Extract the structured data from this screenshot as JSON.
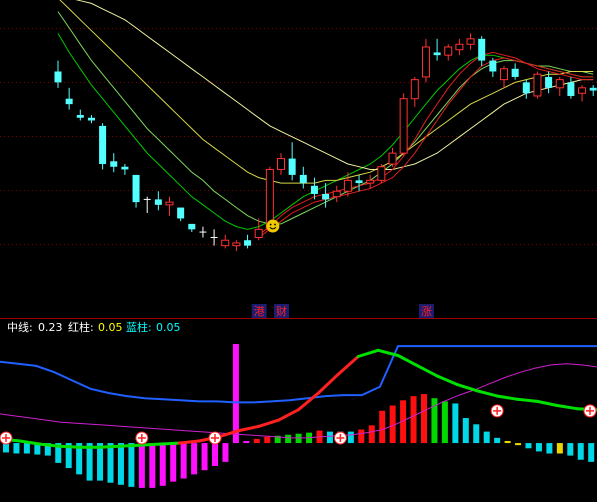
{
  "colors": {
    "background": "#000000",
    "grid": "#7a0000",
    "divider": "#a00000",
    "candle_up": "#ff3232",
    "candle_down": "#54ffff",
    "cross": "#ffffff",
    "ma_green_1": "#00c800",
    "ma_green_2": "#7cd85c",
    "ma_yellow_1": "#d8d848",
    "ma_yellow_2": "#f0f0a0",
    "ma_red": "#e02020",
    "tag_text": "#ff2020",
    "tag_bg": "#1c1c70",
    "ind_mid": "#2060ff",
    "ind_red_col": "#ff1010",
    "ind_blue_col": "#00d8e8",
    "ind_magenta_col": "#ff10ff",
    "ind_green_col": "#00d800",
    "ind_yellow_col": "#e8d800",
    "ind_line_green": "#00e000",
    "ind_line_red": "#ff2020",
    "ind_line_violet": "#d020d0"
  },
  "markers": {
    "smiley_icon": "smiley-face-icon",
    "signal_icon": "crossed-circle-icon"
  },
  "event_tags": [
    "港",
    "财",
    "涨"
  ],
  "indicator_header": {
    "mid_label": "中线:",
    "mid_value": "0.23",
    "red_label": "红柱:",
    "red_value": "0.05",
    "blue_label": "蓝柱:",
    "blue_value": "0.05"
  },
  "chart_data": [
    {
      "type": "candlestick",
      "title": "",
      "xlabel": "",
      "ylabel": "",
      "axis_ticks_shown": false,
      "grid": "dotted horizontal",
      "candles_ohlc": [
        [
          98,
          102,
          92,
          94
        ],
        [
          88,
          92,
          84,
          86
        ],
        [
          82,
          84,
          80,
          81
        ],
        [
          81,
          82,
          79,
          80
        ],
        [
          78,
          79,
          62,
          64
        ],
        [
          65,
          68,
          61,
          63
        ],
        [
          63,
          64,
          60,
          62
        ],
        [
          60,
          60,
          48,
          50
        ],
        [
          51,
          52,
          46,
          51
        ],
        [
          51,
          54,
          47,
          49
        ],
        [
          49,
          52,
          45,
          50
        ],
        [
          48,
          48,
          43,
          44
        ],
        [
          42,
          42,
          39,
          40
        ],
        [
          39,
          41,
          37,
          39
        ],
        [
          37,
          40,
          34,
          37
        ],
        [
          34,
          38,
          33,
          36
        ],
        [
          34,
          36,
          32,
          35
        ],
        [
          36,
          38,
          33,
          34
        ],
        [
          37,
          44,
          36,
          40
        ],
        [
          40,
          63,
          39,
          62
        ],
        [
          62,
          68,
          60,
          66
        ],
        [
          66,
          72,
          58,
          60
        ],
        [
          60,
          63,
          55,
          57
        ],
        [
          56,
          59,
          51,
          53
        ],
        [
          53,
          57,
          48,
          51
        ],
        [
          52,
          56,
          50,
          54
        ],
        [
          54,
          61,
          52,
          58
        ],
        [
          58,
          60,
          54,
          57
        ],
        [
          57,
          60,
          55,
          58
        ],
        [
          58,
          64,
          57,
          63
        ],
        [
          64,
          70,
          63,
          68
        ],
        [
          68,
          90,
          67,
          88
        ],
        [
          88,
          96,
          85,
          95
        ],
        [
          96,
          110,
          94,
          107
        ],
        [
          105,
          110,
          102,
          104
        ],
        [
          104,
          108,
          102,
          107
        ],
        [
          106,
          110,
          104,
          108
        ],
        [
          108,
          112,
          106,
          110
        ],
        [
          110,
          111,
          100,
          102
        ],
        [
          102,
          103,
          96,
          98
        ],
        [
          95,
          100,
          92,
          99
        ],
        [
          99,
          101,
          95,
          96
        ],
        [
          94,
          95,
          88,
          90
        ],
        [
          89,
          98,
          88,
          97
        ],
        [
          96,
          98,
          90,
          92
        ],
        [
          92,
          96,
          89,
          95
        ],
        [
          94,
          96,
          88,
          89
        ],
        [
          90,
          93,
          87,
          92
        ],
        [
          92,
          93,
          89,
          91
        ]
      ],
      "moving_averages": [
        {
          "id": "ma-green-1",
          "values": [
            112,
            105,
            99,
            93,
            88,
            83,
            78,
            73,
            68,
            64,
            60,
            56,
            52,
            49,
            46,
            43,
            41,
            40,
            41,
            43,
            46,
            49,
            52,
            54,
            56,
            58,
            60,
            62,
            64,
            67,
            71,
            76,
            81,
            86,
            91,
            95,
            99,
            102,
            104,
            104,
            103,
            102,
            101,
            100,
            99,
            98,
            97,
            96,
            96
          ]
        },
        {
          "id": "ma-green-2",
          "values": [
            120,
            114,
            108,
            102,
            97,
            92,
            87,
            82,
            77,
            73,
            69,
            65,
            61,
            58,
            54,
            51,
            48,
            45,
            43,
            42,
            42,
            44,
            46,
            48,
            50,
            52,
            54,
            56,
            58,
            61,
            64,
            68,
            72,
            77,
            82,
            87,
            92,
            96,
            99,
            101,
            102,
            102,
            101,
            100,
            100,
            99,
            98,
            98,
            97
          ]
        },
        {
          "id": "ma-yellow-1",
          "values": [
            125,
            121,
            117,
            113,
            109,
            105,
            101,
            97,
            93,
            89,
            85,
            81,
            77,
            73,
            70,
            67,
            64,
            61,
            59,
            58,
            57,
            57,
            57,
            57,
            58,
            58,
            59,
            60,
            61,
            63,
            65,
            68,
            71,
            74,
            77,
            80,
            83,
            86,
            88,
            90,
            92,
            94,
            95,
            96,
            97,
            97,
            98,
            98,
            98
          ]
        },
        {
          "id": "ma-yellow-2",
          "values": [
            125,
            125,
            124,
            123,
            121,
            119,
            117,
            114,
            111,
            108,
            105,
            102,
            99,
            96,
            93,
            90,
            87,
            84,
            81,
            78,
            76,
            74,
            72,
            70,
            68,
            66,
            64,
            63,
            62,
            62,
            62,
            63,
            64,
            66,
            68,
            71,
            74,
            77,
            80,
            83,
            86,
            88,
            90,
            91,
            92,
            93,
            94,
            95,
            95
          ]
        },
        {
          "id": "ma-red-1",
          "values": [
            null,
            null,
            null,
            null,
            null,
            null,
            null,
            null,
            null,
            null,
            null,
            null,
            null,
            null,
            null,
            null,
            null,
            null,
            38,
            41,
            45,
            48,
            50,
            52,
            53,
            54,
            55,
            56,
            57,
            59,
            62,
            67,
            73,
            80,
            86,
            92,
            97,
            101,
            104,
            105,
            104,
            103,
            101,
            99,
            98,
            97,
            96,
            95,
            95
          ]
        },
        {
          "id": "ma-red-2",
          "values": [
            null,
            null,
            null,
            null,
            null,
            null,
            null,
            null,
            null,
            null,
            null,
            null,
            null,
            null,
            null,
            null,
            null,
            null,
            37,
            40,
            43,
            46,
            48,
            50,
            51,
            52,
            53,
            54,
            55,
            57,
            59,
            63,
            68,
            74,
            80,
            86,
            91,
            96,
            100,
            102,
            103,
            102,
            101,
            100,
            99,
            98,
            97,
            96,
            96
          ]
        }
      ],
      "smiley_candle_index": 19,
      "event_tag_candle_indices": [
        18,
        20,
        33
      ]
    },
    {
      "type": "bar",
      "title": "",
      "series_shown": [
        "中线",
        "红柱",
        "蓝柱"
      ],
      "ylim": [
        -4.5,
        9.5
      ],
      "histogram": [
        {
          "v": -0.9,
          "c": "blue"
        },
        {
          "v": -1.0,
          "c": "blue"
        },
        {
          "v": -1.0,
          "c": "blue"
        },
        {
          "v": -1.1,
          "c": "blue"
        },
        {
          "v": -1.2,
          "c": "blue"
        },
        {
          "v": -1.9,
          "c": "blue"
        },
        {
          "v": -2.4,
          "c": "blue"
        },
        {
          "v": -3.0,
          "c": "blue"
        },
        {
          "v": -3.6,
          "c": "blue"
        },
        {
          "v": -3.6,
          "c": "blue"
        },
        {
          "v": -3.8,
          "c": "blue"
        },
        {
          "v": -4.0,
          "c": "blue"
        },
        {
          "v": -4.2,
          "c": "blue"
        },
        {
          "v": -4.3,
          "c": "magenta"
        },
        {
          "v": -4.3,
          "c": "magenta"
        },
        {
          "v": -4.1,
          "c": "magenta"
        },
        {
          "v": -3.7,
          "c": "magenta"
        },
        {
          "v": -3.4,
          "c": "magenta"
        },
        {
          "v": -3.0,
          "c": "magenta"
        },
        {
          "v": -2.6,
          "c": "magenta"
        },
        {
          "v": -2.2,
          "c": "magenta"
        },
        {
          "v": -1.8,
          "c": "magenta"
        },
        {
          "v": 9.5,
          "c": "magenta"
        },
        {
          "v": 0.2,
          "c": "magenta"
        },
        {
          "v": 0.4,
          "c": "red"
        },
        {
          "v": 0.6,
          "c": "red"
        },
        {
          "v": 0.7,
          "c": "green"
        },
        {
          "v": 0.8,
          "c": "green"
        },
        {
          "v": 0.9,
          "c": "green"
        },
        {
          "v": 1.0,
          "c": "green"
        },
        {
          "v": 1.2,
          "c": "red"
        },
        {
          "v": 1.1,
          "c": "blue"
        },
        {
          "v": 1.1,
          "c": "blue"
        },
        {
          "v": 1.1,
          "c": "blue"
        },
        {
          "v": 1.3,
          "c": "red"
        },
        {
          "v": 1.7,
          "c": "red"
        },
        {
          "v": 3.1,
          "c": "red"
        },
        {
          "v": 3.6,
          "c": "red"
        },
        {
          "v": 4.1,
          "c": "red"
        },
        {
          "v": 4.5,
          "c": "red"
        },
        {
          "v": 4.7,
          "c": "red"
        },
        {
          "v": 4.3,
          "c": "green"
        },
        {
          "v": 4.0,
          "c": "green"
        },
        {
          "v": 3.8,
          "c": "blue"
        },
        {
          "v": 2.4,
          "c": "blue"
        },
        {
          "v": 1.8,
          "c": "blue"
        },
        {
          "v": 1.1,
          "c": "blue"
        },
        {
          "v": 0.5,
          "c": "blue"
        },
        {
          "v": 0.2,
          "c": "yellow"
        },
        {
          "v": -0.2,
          "c": "yellow"
        },
        {
          "v": -0.5,
          "c": "blue"
        },
        {
          "v": -0.8,
          "c": "blue"
        },
        {
          "v": -1.0,
          "c": "blue"
        },
        {
          "v": -1.0,
          "c": "yellow"
        },
        {
          "v": -1.2,
          "c": "blue"
        },
        {
          "v": -1.6,
          "c": "blue"
        },
        {
          "v": -1.8,
          "c": "blue"
        }
      ],
      "mid_line_blue": [
        7.8,
        7.6,
        7.4,
        6.8,
        6.0,
        5.2,
        4.8,
        4.5,
        4.3,
        4.2,
        4.1,
        4.0,
        4.0,
        3.9,
        3.9,
        4.0,
        4.1,
        4.3,
        4.5,
        4.6,
        4.6,
        5.4,
        9.3,
        9.3,
        9.3,
        9.3,
        9.3,
        9.3,
        9.3,
        9.3,
        9.3,
        9.3,
        9.3,
        9.3
      ],
      "violet_line": [
        2.8,
        2.6,
        2.4,
        2.2,
        2.0,
        1.9,
        1.8,
        1.7,
        1.6,
        1.5,
        1.4,
        1.3,
        1.2,
        1.1,
        1.0,
        0.9,
        0.8,
        0.7,
        0.6,
        0.5,
        0.5,
        0.6,
        0.7,
        0.8,
        1.0,
        1.3,
        1.9,
        2.6,
        3.3,
        4.0,
        4.6,
        5.1,
        5.7,
        6.3,
        6.8,
        7.2,
        7.5,
        7.6,
        7.5,
        7.3
      ],
      "green_red_line": [
        {
          "v": 0.4,
          "c": "green"
        },
        {
          "v": 0.2,
          "c": "green"
        },
        {
          "v": -0.1,
          "c": "green"
        },
        {
          "v": -0.3,
          "c": "green"
        },
        {
          "v": -0.4,
          "c": "green"
        },
        {
          "v": -0.4,
          "c": "green"
        },
        {
          "v": -0.3,
          "c": "green"
        },
        {
          "v": -0.2,
          "c": "green"
        },
        {
          "v": -0.1,
          "c": "green"
        },
        {
          "v": 0.0,
          "c": "green"
        },
        {
          "v": 0.2,
          "c": "red"
        },
        {
          "v": 0.6,
          "c": "red"
        },
        {
          "v": 1.2,
          "c": "red"
        },
        {
          "v": 1.6,
          "c": "red"
        },
        {
          "v": 2.2,
          "c": "red"
        },
        {
          "v": 3.2,
          "c": "red"
        },
        {
          "v": 4.8,
          "c": "red"
        },
        {
          "v": 6.6,
          "c": "red"
        },
        {
          "v": 8.3,
          "c": "red"
        },
        {
          "v": 8.9,
          "c": "green"
        },
        {
          "v": 8.4,
          "c": "green"
        },
        {
          "v": 7.4,
          "c": "green"
        },
        {
          "v": 6.4,
          "c": "green"
        },
        {
          "v": 5.6,
          "c": "green"
        },
        {
          "v": 5.0,
          "c": "green"
        },
        {
          "v": 4.5,
          "c": "green"
        },
        {
          "v": 4.2,
          "c": "green"
        },
        {
          "v": 4.0,
          "c": "green"
        },
        {
          "v": 3.6,
          "c": "green"
        },
        {
          "v": 3.3,
          "c": "green"
        },
        {
          "v": 3.2,
          "c": "green"
        }
      ],
      "signal_marker_bar_indices": [
        0,
        13,
        20,
        32,
        47,
        76,
        81
      ]
    }
  ]
}
